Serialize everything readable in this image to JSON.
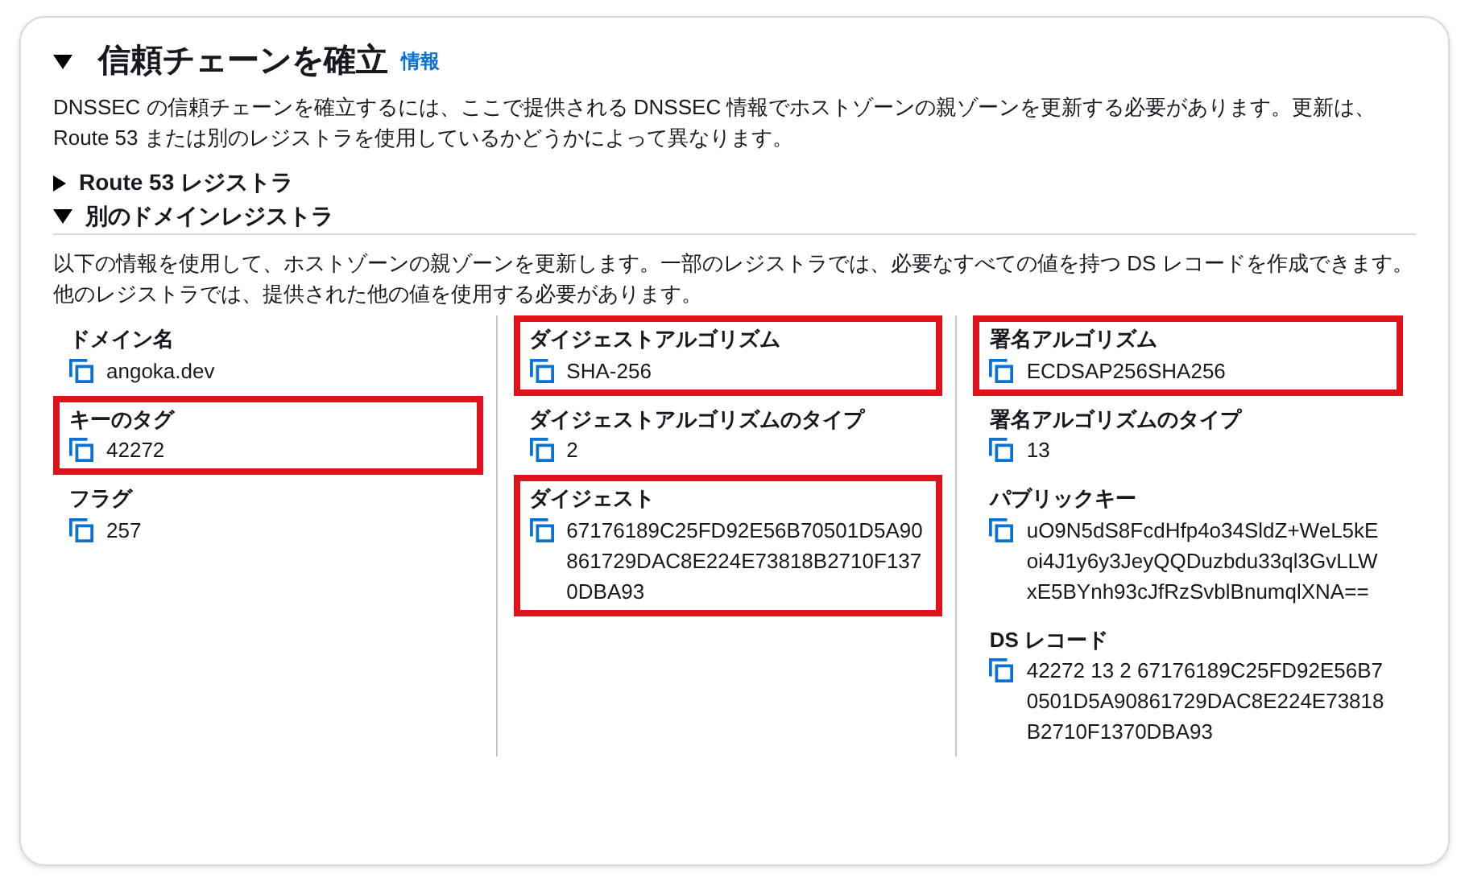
{
  "panel": {
    "title": "信頼チェーンを確立",
    "expanded": true,
    "info_link": "情報",
    "description": "DNSSEC の信頼チェーンを確立するには、ここで提供される DNSSEC 情報でホストゾーンの親ゾーンを更新する必要があります。更新は、Route 53 または別のレジストラを使用しているかどうかによって異なります。"
  },
  "sections": [
    {
      "title": "Route 53 レジストラ",
      "expanded": false
    },
    {
      "title": "別のドメインレジストラ",
      "expanded": true,
      "description": "以下の情報を使用して、ホストゾーンの親ゾーンを更新します。一部のレジストラでは、必要なすべての値を持つ DS レコードを作成できます。他のレジストラでは、提供された他の値を使用する必要があります。",
      "columns": [
        [
          {
            "label": "ドメイン名",
            "value": "angoka.dev",
            "highlighted": false
          },
          {
            "label": "キーのタグ",
            "value": "42272",
            "highlighted": true
          },
          {
            "label": "フラグ",
            "value": "257",
            "highlighted": false
          }
        ],
        [
          {
            "label": "ダイジェストアルゴリズム",
            "value": "SHA-256",
            "highlighted": true
          },
          {
            "label": "ダイジェストアルゴリズムのタイプ",
            "value": "2",
            "highlighted": false
          },
          {
            "label": "ダイジェスト",
            "value": "67176189C25FD92E56B70501D5A90861729DAC8E224E73818B2710F1370DBA93",
            "highlighted": true
          }
        ],
        [
          {
            "label": "署名アルゴリズム",
            "value": "ECDSAP256SHA256",
            "highlighted": true
          },
          {
            "label": "署名アルゴリズムのタイプ",
            "value": "13",
            "highlighted": false
          },
          {
            "label": "パブリックキー",
            "value": "uO9N5dS8FcdHfp4o34SldZ+WeL5kEoi4J1y6y3JeyQQDuzbdu33ql3GvLLWxE5BYnh93cJfRzSvblBnumqlXNA==",
            "highlighted": false
          },
          {
            "label": "DS レコード",
            "value": "42272 13 2 67176189C25FD92E56B70501D5A90861729DAC8E224E73818B2710F1370DBA93",
            "highlighted": false
          }
        ]
      ]
    }
  ]
}
